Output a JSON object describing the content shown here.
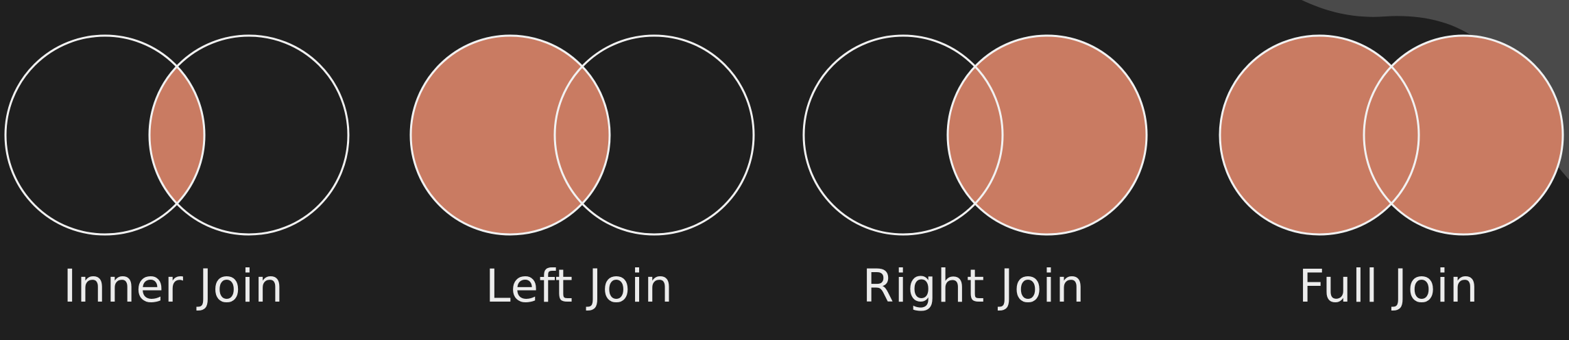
{
  "colors": {
    "background": "#1f1f1f",
    "fill": "#c97b62",
    "outline": "#f2f2f2",
    "corner_shape": "#4a4a4a"
  },
  "diagrams": [
    {
      "label": "Inner Join",
      "fill": "intersection"
    },
    {
      "label": "Left Join",
      "fill": "left"
    },
    {
      "label": "Right Join",
      "fill": "right"
    },
    {
      "label": "Full Join",
      "fill": "both"
    }
  ]
}
